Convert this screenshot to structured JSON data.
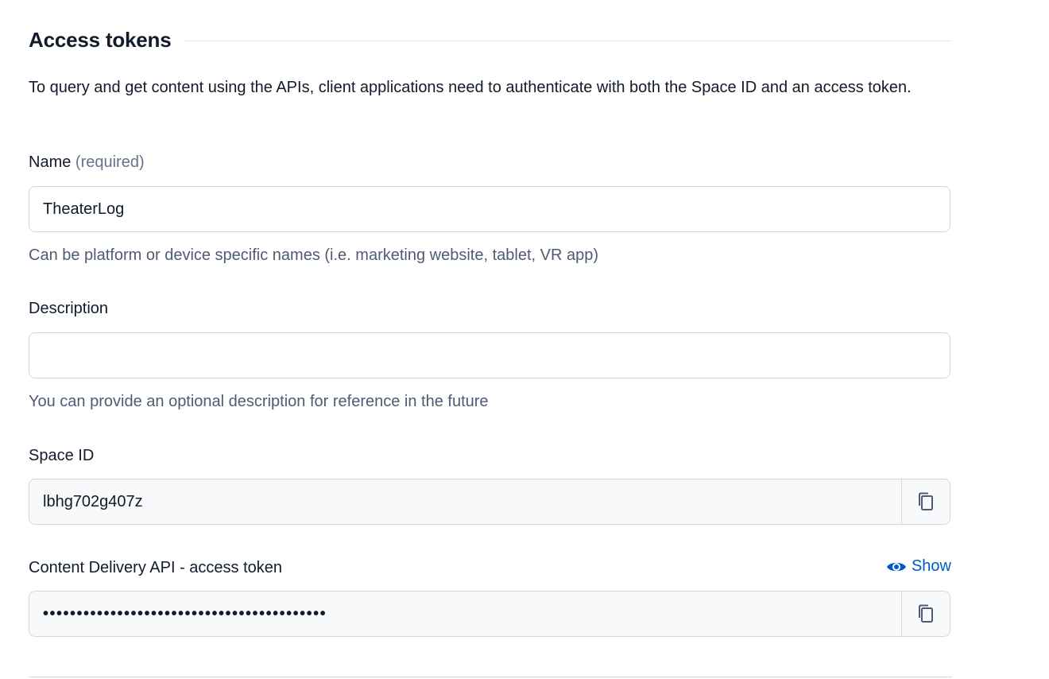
{
  "section": {
    "title": "Access tokens",
    "intro": "To query and get content using the APIs, client applications need to authenticate with both the Space ID and an access token."
  },
  "name_field": {
    "label": "Name",
    "required_hint": "(required)",
    "value": "TheaterLog",
    "help": "Can be platform or device specific names (i.e. marketing website, tablet, VR app)"
  },
  "description_field": {
    "label": "Description",
    "value": "",
    "help": "You can provide an optional description for reference in the future"
  },
  "space_id_field": {
    "label": "Space ID",
    "value": "lbhg702g407z",
    "copy_icon": "copy-icon"
  },
  "cda_token_field": {
    "label": "Content Delivery API - access token",
    "show_label": "Show",
    "show_icon": "eye-icon",
    "masked_value": "••••••••••••••••••••••••••••••••••••••••••",
    "copy_icon": "copy-icon"
  },
  "colors": {
    "link": "#0059c8",
    "text": "#111b2b",
    "muted": "#4f5b75",
    "border": "#cfd9e0",
    "readonly_bg": "#f7f9fa"
  }
}
